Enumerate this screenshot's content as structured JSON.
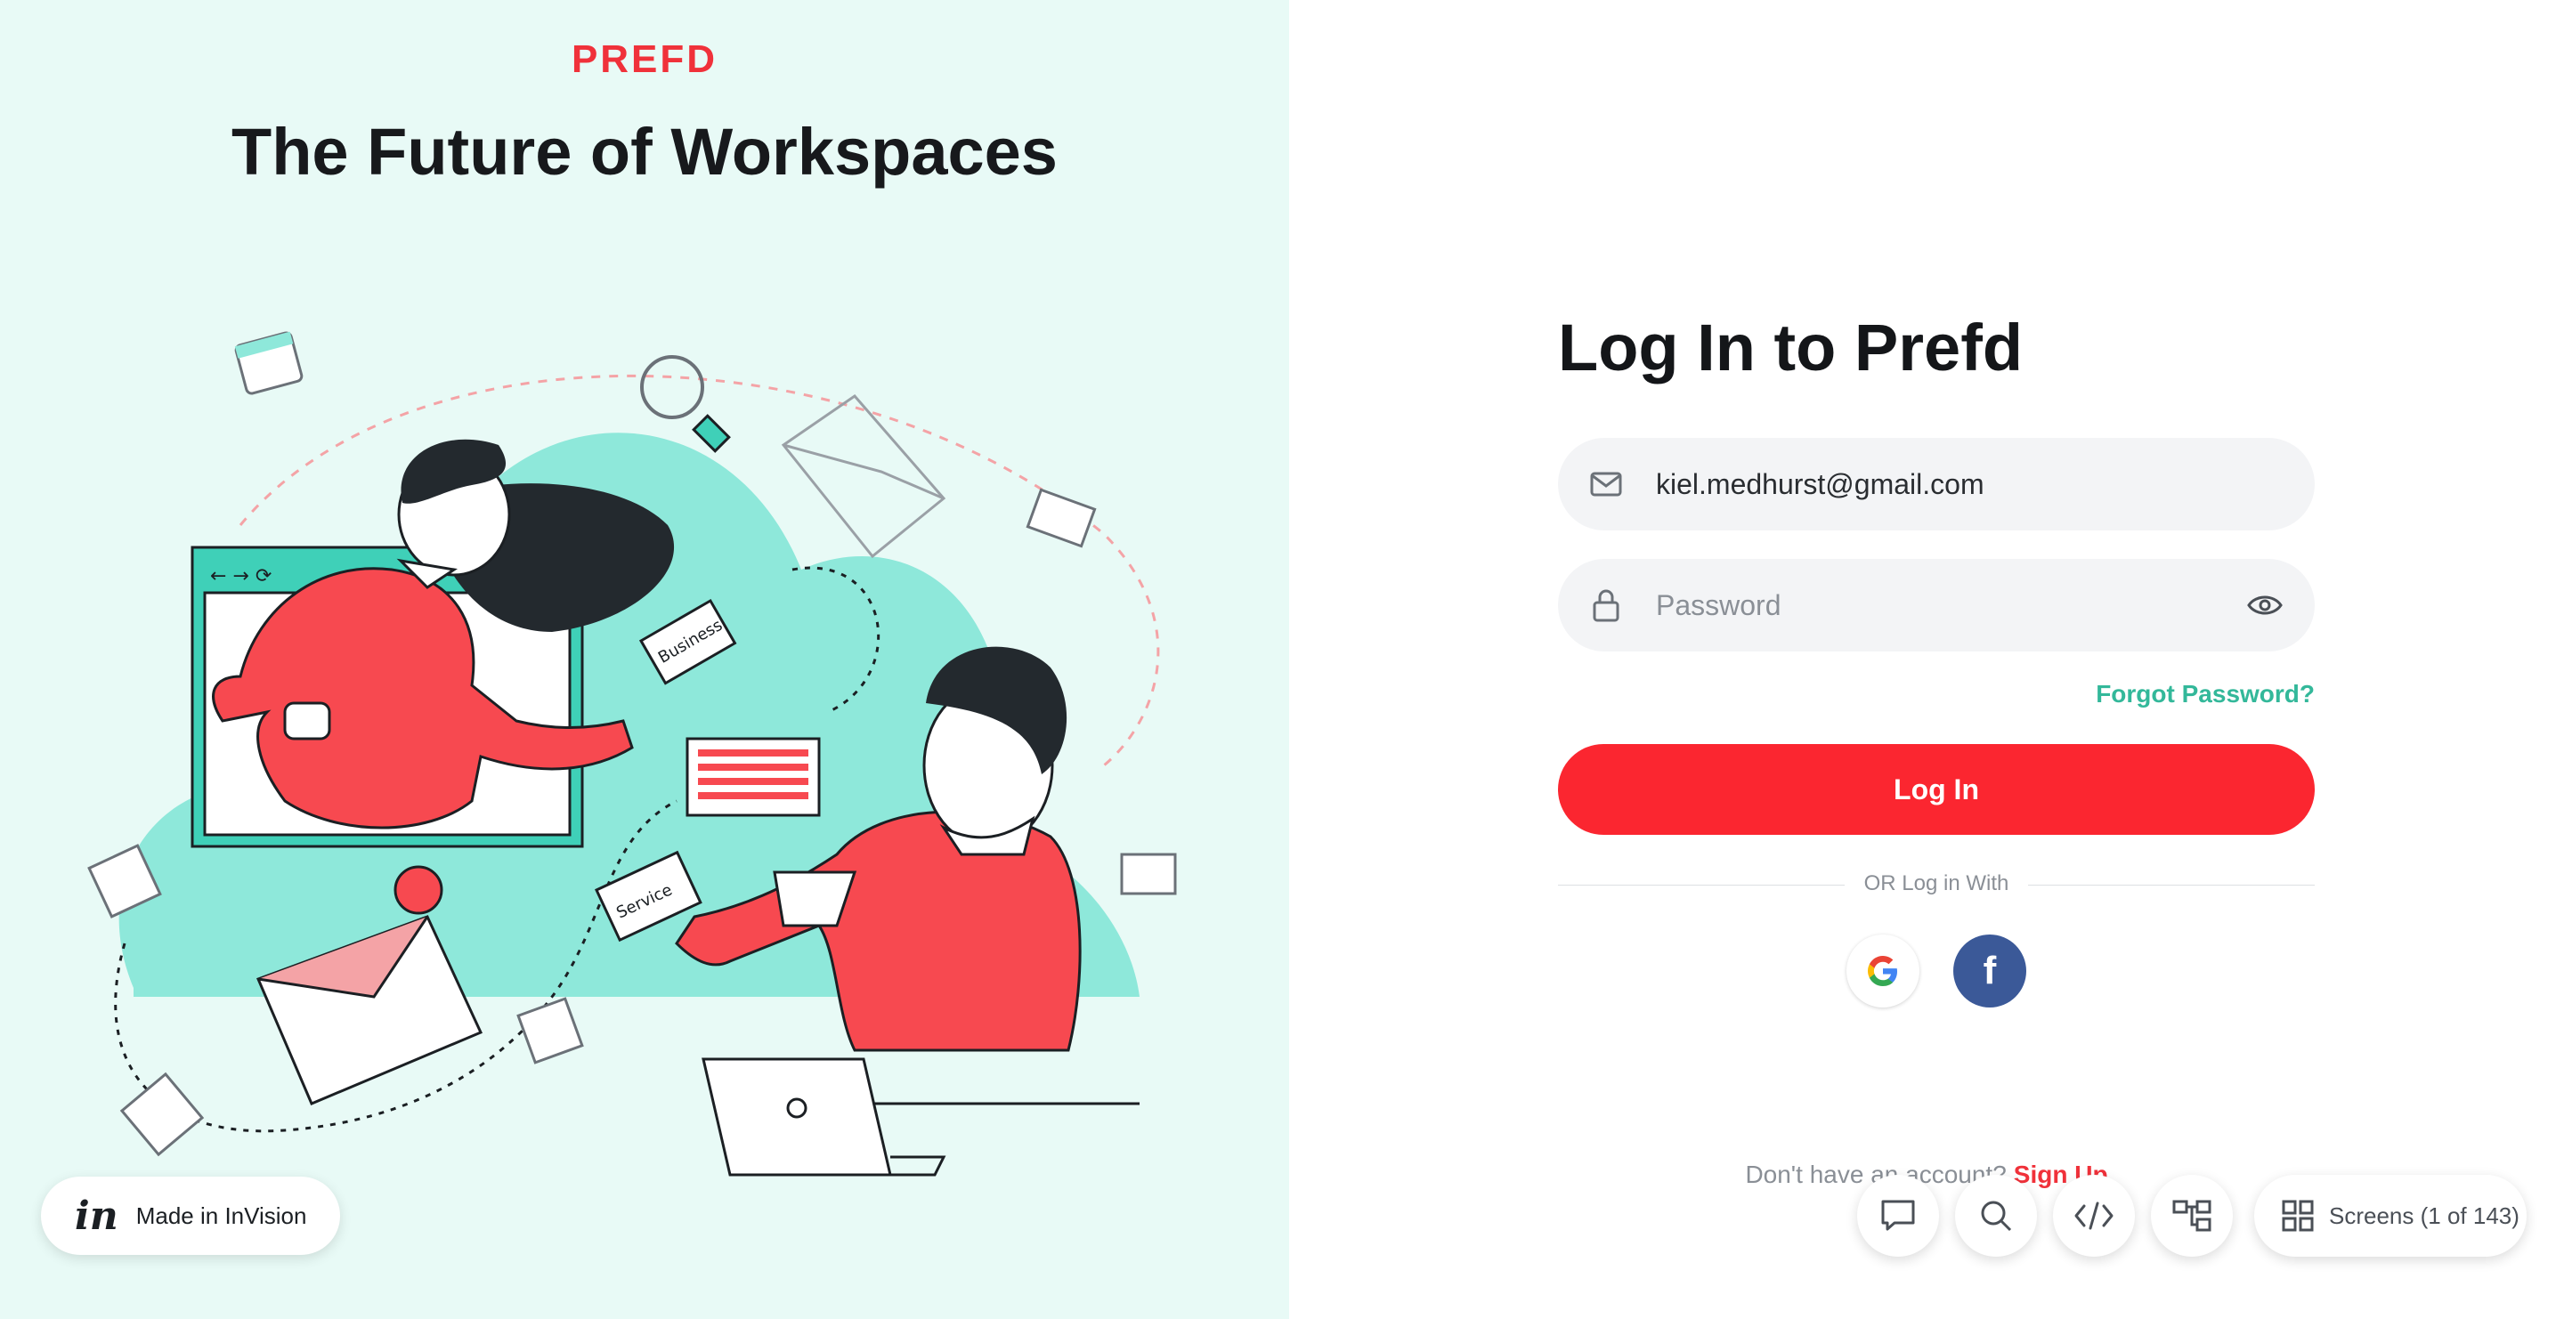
{
  "left_panel": {
    "brand": "PREFD",
    "tagline": "The Future of Workspaces",
    "illustration": {
      "card_business": "Business",
      "card_service": "Service"
    },
    "badge": {
      "logo": "in",
      "label": "Made in InVision"
    }
  },
  "login": {
    "title": "Log In to Prefd",
    "email": {
      "value": "kiel.medhurst@gmail.com",
      "icon": "mail-icon"
    },
    "password": {
      "placeholder": "Password",
      "icon": "lock-icon",
      "toggle_icon": "eye-icon"
    },
    "forgot_label": "Forgot Password?",
    "submit_label": "Log In",
    "divider_label": "OR Log in With",
    "social": [
      {
        "name": "google",
        "icon": "google-icon"
      },
      {
        "name": "facebook",
        "icon": "facebook-icon",
        "glyph": "f"
      }
    ],
    "signup_prompt": "Don't have an account?",
    "signup_link": "Sign Up"
  },
  "toolbar": {
    "buttons": [
      "comment-icon",
      "search-icon",
      "code-icon",
      "flow-icon"
    ],
    "screens_label": "Screens (1 of 143)"
  },
  "colors": {
    "brand_red": "#fb2630",
    "mint_bg": "#e8faf6",
    "mint_blob": "#8ee8da",
    "teal_link": "#33b89a",
    "facebook_blue": "#3b5998"
  }
}
